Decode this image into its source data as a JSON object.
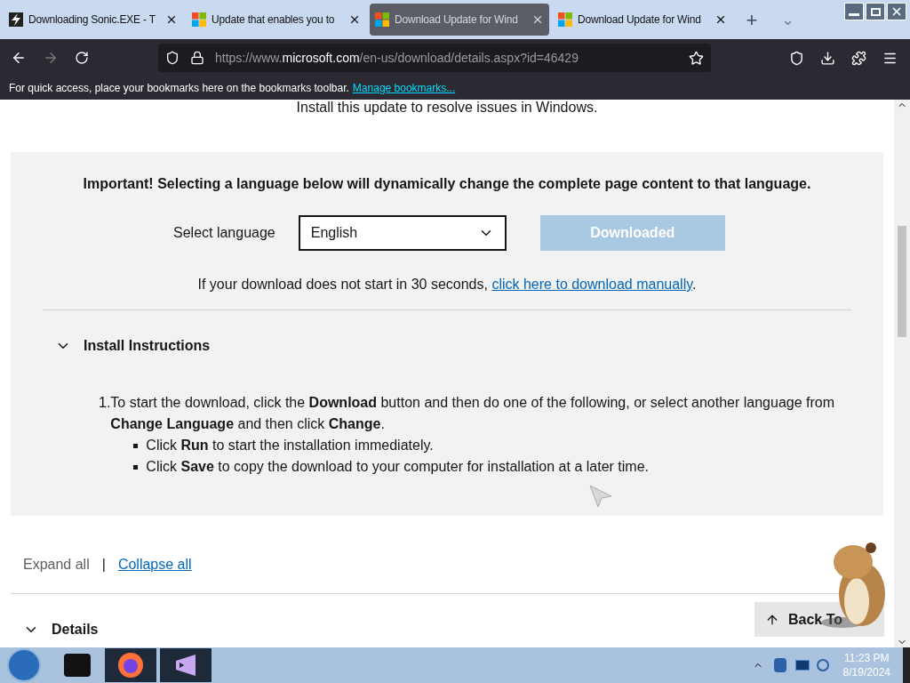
{
  "browser": {
    "tabs": [
      {
        "title": "Downloading Sonic.EXE - T",
        "selected": false
      },
      {
        "title": "Update that enables you to",
        "selected": false
      },
      {
        "title": "Download Update for Wind",
        "selected": true
      },
      {
        "title": "Download Update for Wind",
        "selected": false
      }
    ],
    "new_tab": "+",
    "tab_list": "⌄",
    "url_prefix": "https://www.",
    "url_domain": "microsoft.com",
    "url_path": "/en-us/download/details.aspx?id=46429",
    "bookmarks_hint": "For quick access, place your bookmarks here on the bookmarks toolbar.",
    "manage_bookmarks": "Manage bookmarks..."
  },
  "page": {
    "intro": "Install this update to resolve issues in Windows.",
    "important": "Important! Selecting a language below will dynamically change the complete page content to that language.",
    "select_label": "Select language",
    "language": "English",
    "download_button": {
      "label": "Downloaded",
      "disabled": true
    },
    "manual_text": "If your download does not start in 30 seconds,",
    "manual_link": "click here to download manually",
    "manual_end": ".",
    "sections": [
      {
        "title": "Install Instructions",
        "expanded": true,
        "steps": [
          {
            "number": "1.",
            "text": "To start the download, click the **Download** button and then do one of the following, or select another language from **Change Language** and then click **Change**.",
            "bullets": [
              "Click **Run** to start the installation immediately.",
              "Click **Save** to copy the download to your computer for installation at a later time."
            ]
          }
        ]
      }
    ],
    "expand_all": "Expand all",
    "separator": "|",
    "collapse_all": "Collapse all",
    "details": {
      "title": "Details",
      "expanded": false
    },
    "back_to_top": "Back To"
  },
  "taskbar": {
    "time": "11:23 PM",
    "date": "8/19/2024"
  }
}
